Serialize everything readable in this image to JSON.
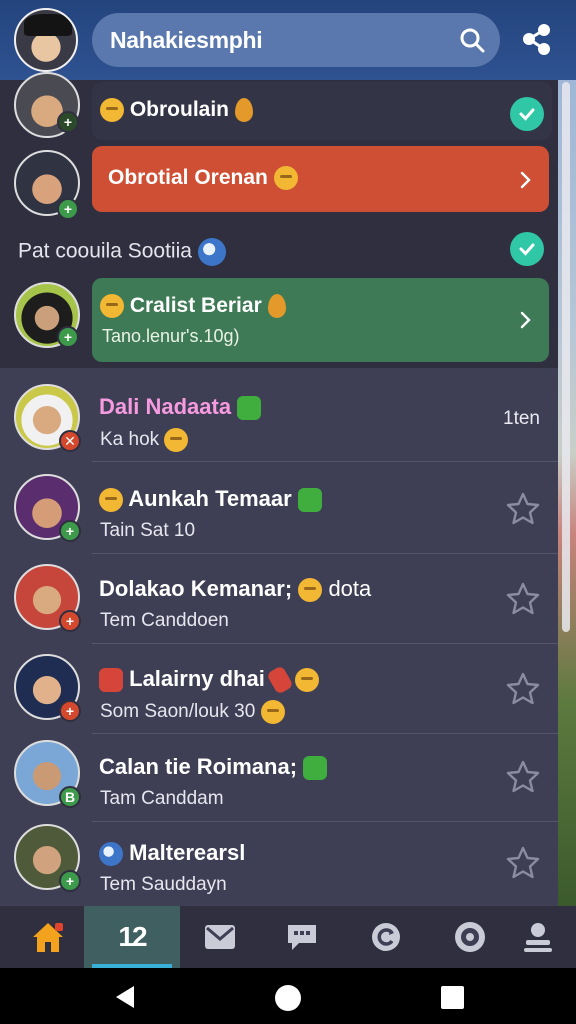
{
  "header": {
    "title": "Nahakiesmphi"
  },
  "pinned": [
    {
      "name": "Obroulain",
      "checked": true
    },
    {
      "name": "Obrotial Orenan",
      "accent": "#cf4f35"
    },
    {
      "name": "Pat coouila Sootiia",
      "checked": true
    },
    {
      "name": "Cralist Beriar",
      "subtitle": "Tano.lenur's.10g)",
      "accent": "#3e7a55"
    }
  ],
  "chats": [
    {
      "name": "Dali Nadaata",
      "subtitle": "Ka hok",
      "time": "1ten"
    },
    {
      "name": "Aunkah Temaar",
      "subtitle": "Tain Sat 10"
    },
    {
      "name": "Dolakao Kemanar;",
      "name_suffix": "dota",
      "subtitle": "Tem Canddoen"
    },
    {
      "name": "Lalairny dhai",
      "subtitle": "Som Saon/louk 30"
    },
    {
      "name": "Calan tie Roimana;",
      "subtitle": "Tam Canddam"
    },
    {
      "name": "Malterearsl",
      "subtitle": "Tem Sauddayn"
    }
  ],
  "bottom_nav": {
    "active_label": "12"
  },
  "colors": {
    "header": "#2a4a86",
    "background": "#3e3e55",
    "active_tab": "#3f5f61",
    "check": "#2fc7a6"
  }
}
